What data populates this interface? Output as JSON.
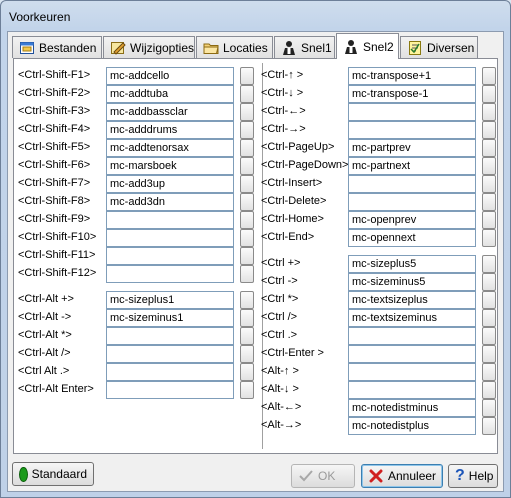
{
  "window": {
    "title": "Voorkeuren"
  },
  "tabs": [
    {
      "label": "Bestanden",
      "icon": "form-icon",
      "active": false
    },
    {
      "label": "Wijzigopties",
      "icon": "edit-picture-icon",
      "active": false
    },
    {
      "label": "Locaties",
      "icon": "folder-icon",
      "active": false
    },
    {
      "label": "Snel1",
      "icon": "person-icon",
      "active": false
    },
    {
      "label": "Snel2",
      "icon": "person-icon",
      "active": true
    },
    {
      "label": "Diversen",
      "icon": "notepad-icon",
      "active": false
    }
  ],
  "left_group1": [
    {
      "key": "<Ctrl-Shift-F1>",
      "value": "mc-addcello"
    },
    {
      "key": "<Ctrl-Shift-F2>",
      "value": "mc-addtuba"
    },
    {
      "key": "<Ctrl-Shift-F3>",
      "value": "mc-addbassclar"
    },
    {
      "key": "<Ctrl-Shift-F4>",
      "value": "mc-adddrums"
    },
    {
      "key": "<Ctrl-Shift-F5>",
      "value": "mc-addtenorsax"
    },
    {
      "key": "<Ctrl-Shift-F6>",
      "value": "mc-marsboek"
    },
    {
      "key": "<Ctrl-Shift-F7>",
      "value": "mc-add3up"
    },
    {
      "key": "<Ctrl-Shift-F8>",
      "value": "mc-add3dn"
    },
    {
      "key": "<Ctrl-Shift-F9>",
      "value": ""
    },
    {
      "key": "<Ctrl-Shift-F10>",
      "value": ""
    },
    {
      "key": "<Ctrl-Shift-F11>",
      "value": ""
    },
    {
      "key": "<Ctrl-Shift-F12>",
      "value": ""
    }
  ],
  "left_group2": [
    {
      "key": "<Ctrl-Alt +>",
      "value": "mc-sizeplus1"
    },
    {
      "key": "<Ctrl-Alt ->",
      "value": "mc-sizeminus1"
    },
    {
      "key": "<Ctrl-Alt *>",
      "value": ""
    },
    {
      "key": "<Ctrl-Alt />",
      "value": ""
    },
    {
      "key": "<Ctrl Alt .>",
      "value": ""
    },
    {
      "key": "<Ctrl-Alt Enter>",
      "value": ""
    }
  ],
  "right_group1": [
    {
      "key": "<Ctrl-↑ >",
      "value": "mc-transpose+1"
    },
    {
      "key": "<Ctrl-↓ >",
      "value": "mc-transpose-1"
    },
    {
      "key": "<Ctrl-←>",
      "value": ""
    },
    {
      "key": "<Ctrl-→>",
      "value": ""
    },
    {
      "key": "<Ctrl-PageUp>",
      "value": "mc-partprev"
    },
    {
      "key": "<Ctrl-PageDown>",
      "value": "mc-partnext"
    },
    {
      "key": "<Ctrl-Insert>",
      "value": ""
    },
    {
      "key": "<Ctrl-Delete>",
      "value": ""
    },
    {
      "key": "<Ctrl-Home>",
      "value": "mc-openprev"
    },
    {
      "key": "<Ctrl-End>",
      "value": "mc-opennext"
    }
  ],
  "right_group2": [
    {
      "key": "<Ctrl +>",
      "value": "mc-sizeplus5"
    },
    {
      "key": "<Ctrl ->",
      "value": "mc-sizeminus5"
    },
    {
      "key": "<Ctrl *>",
      "value": "mc-textsizeplus"
    },
    {
      "key": "<Ctrl />",
      "value": "mc-textsizeminus"
    },
    {
      "key": "<Ctrl .>",
      "value": ""
    },
    {
      "key": "<Ctrl-Enter >",
      "value": ""
    },
    {
      "key": "<Alt-↑ >",
      "value": ""
    },
    {
      "key": "<Alt-↓ >",
      "value": ""
    },
    {
      "key": "<Alt-←>",
      "value": "mc-notedistminus"
    },
    {
      "key": "<Alt-→>",
      "value": "mc-notedistplus"
    }
  ],
  "footer": {
    "standaard_label": "Standaard",
    "ok_label": "OK",
    "annuleer_label": "Annuleer",
    "help_label": "Help"
  },
  "colors": {
    "standaard_dot": "#1a9a1a",
    "cancel_x": "#d02020",
    "help_icon": "#1c55b8"
  }
}
